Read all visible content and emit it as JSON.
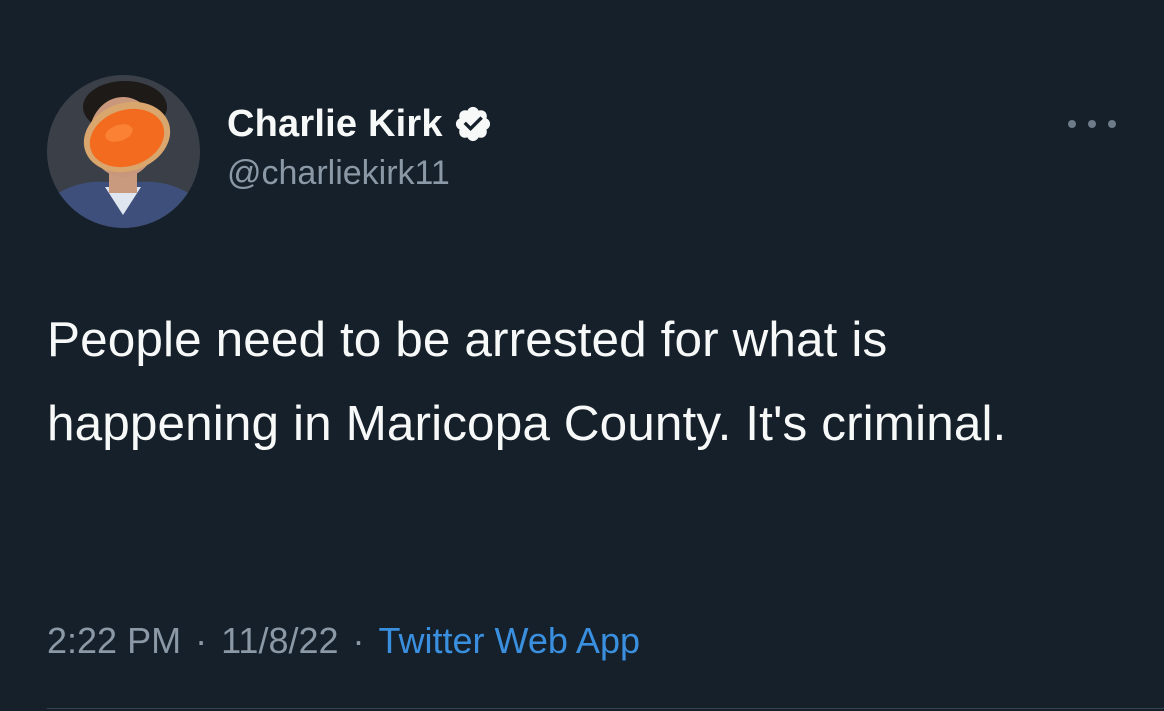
{
  "tweet": {
    "author": {
      "display_name": "Charlie Kirk",
      "handle": "@charliekirk11",
      "verified": true,
      "avatar_icon": "profile-avatar"
    },
    "more_icon": "more-options-icon",
    "text": "People need to be arrested for what is happening in Maricopa County. It's criminal.",
    "time": "2:22 PM",
    "separator": "·",
    "date": "11/8/22",
    "source": "Twitter Web App"
  },
  "colors": {
    "background": "#15202b",
    "primary_text": "#f7f9f9",
    "secondary_text": "#8b98a5",
    "link": "#3a8fdf",
    "verified_badge": "#f7f9f9"
  }
}
